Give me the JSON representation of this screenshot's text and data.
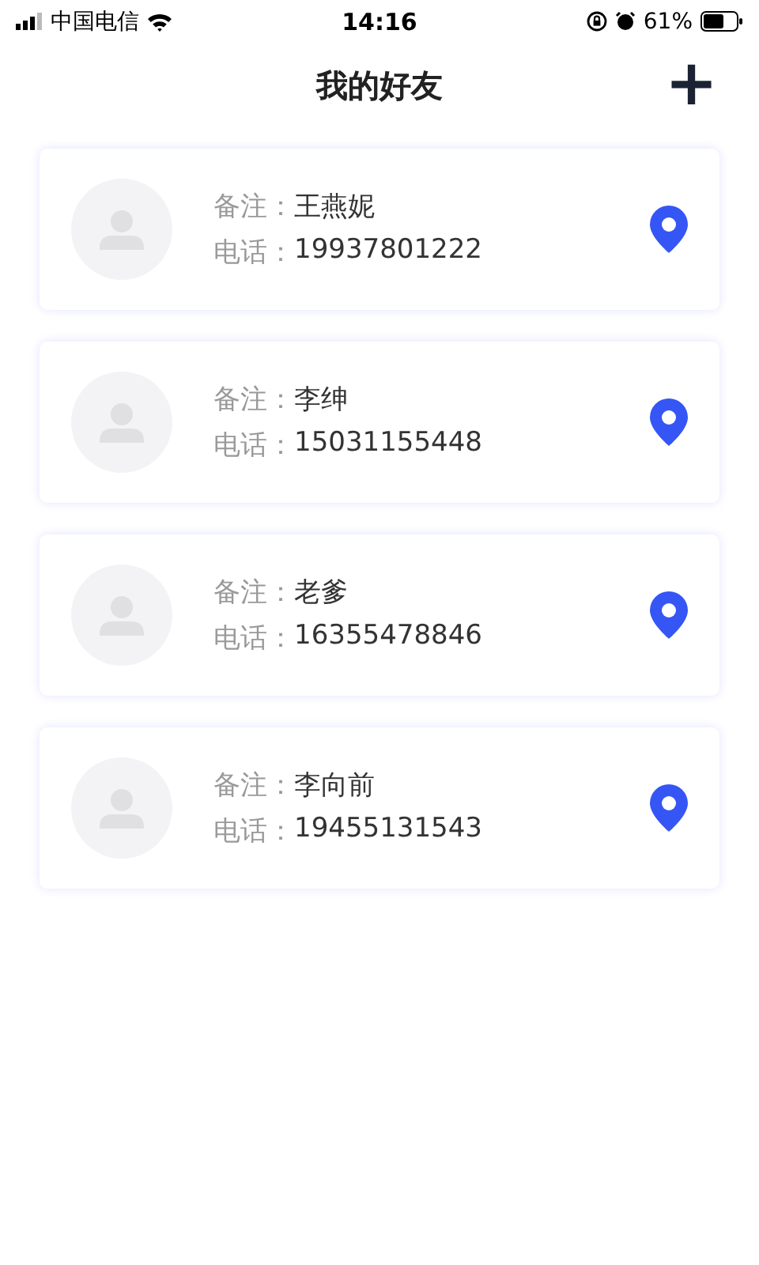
{
  "status_bar": {
    "carrier": "中国电信",
    "time": "14:16",
    "battery": "61%"
  },
  "nav": {
    "title": "我的好友",
    "add": "+"
  },
  "friends": [
    {
      "note_label": "备注：",
      "note": "王燕妮",
      "phone_label": "电话：",
      "phone": "19937801222"
    },
    {
      "note_label": "备注：",
      "note": "李绅",
      "phone_label": "电话：",
      "phone": "15031155448"
    },
    {
      "note_label": "备注：",
      "note": "老爹",
      "phone_label": "电话：",
      "phone": "16355478846"
    },
    {
      "note_label": "备注：",
      "note": "李向前",
      "phone_label": "电话：",
      "phone": "19455131543"
    }
  ]
}
